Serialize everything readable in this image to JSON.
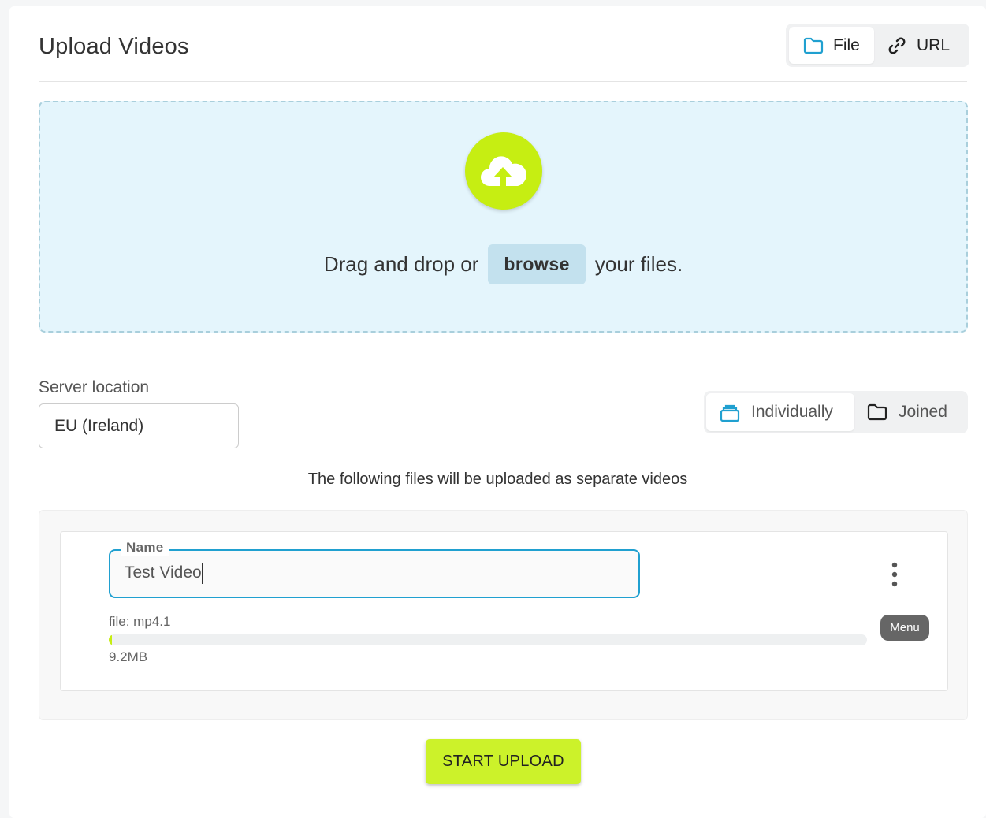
{
  "header": {
    "title": "Upload Videos",
    "source_tabs": [
      {
        "label": "File",
        "icon": "folder-icon",
        "active": true
      },
      {
        "label": "URL",
        "icon": "link-icon",
        "active": false
      }
    ]
  },
  "dropzone": {
    "icon": "cloud-upload-icon",
    "text_before": "Drag and drop or",
    "browse_label": "browse",
    "text_after": "your files."
  },
  "server": {
    "label": "Server location",
    "selected": "EU (Ireland)"
  },
  "mode_tabs": [
    {
      "label": "Individually",
      "icon": "stack-icon",
      "active": true
    },
    {
      "label": "Joined",
      "icon": "folder-icon",
      "active": false
    }
  ],
  "info_text": "The following files will be uploaded as separate videos",
  "file_item": {
    "name_label": "Name",
    "name_value": "Test Video",
    "file_label": "file: mp4.1",
    "progress_percent": 0.3,
    "size": "9.2MB",
    "menu_tooltip": "Menu"
  },
  "start_button": "START UPLOAD",
  "colors": {
    "accent_lime": "#c6ee12",
    "accent_blue": "#20a0d0",
    "dropzone_bg": "#e4f5fc"
  }
}
